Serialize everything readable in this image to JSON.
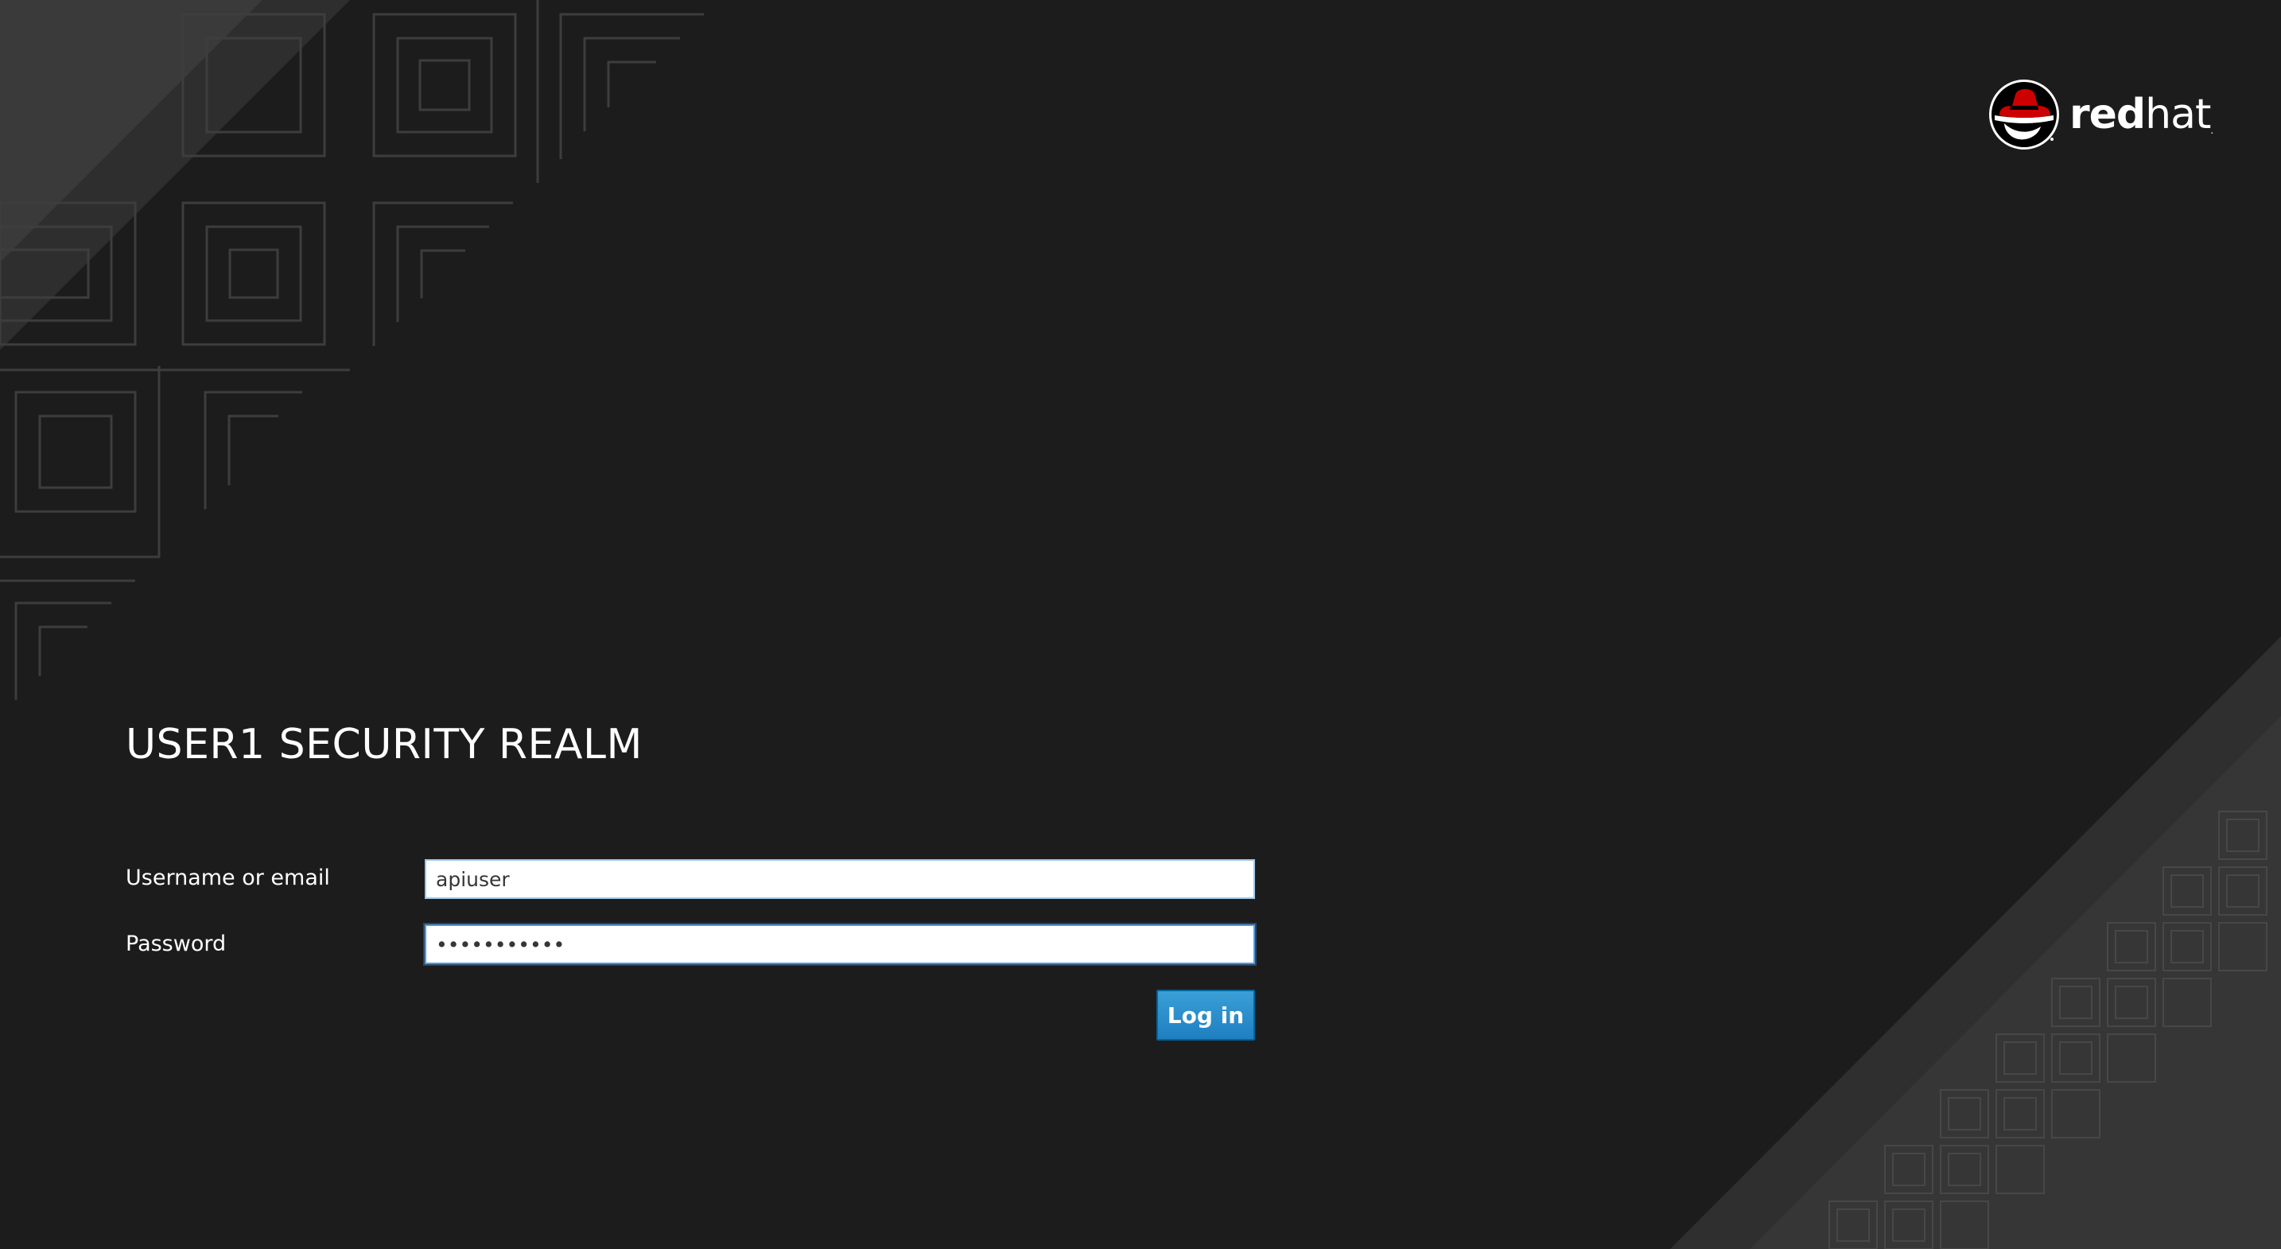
{
  "brand": {
    "logo_icon": "redhat-shadowman-icon",
    "wordmark_bold": "red",
    "wordmark_light": "hat",
    "wordmark_tm": ".",
    "accent_color": "#cc0000"
  },
  "realm": {
    "title": "USER1 SECURITY REALM"
  },
  "form": {
    "username_label": "Username or email",
    "username_value": "apiuser",
    "password_label": "Password",
    "password_value": "•••••••••••",
    "submit_label": "Log in"
  },
  "colors": {
    "background": "#1c1c1d",
    "button": "#2b8fcf",
    "focus_border": "#4d9ce0"
  }
}
